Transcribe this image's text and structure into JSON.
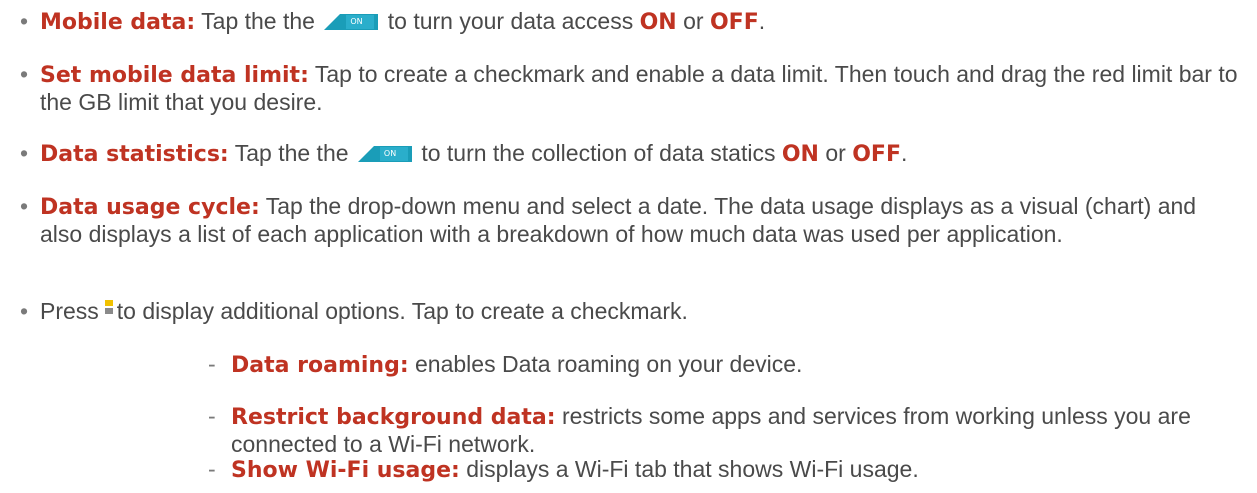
{
  "bullet": "•",
  "dash": "-",
  "items": [
    {
      "term": "Mobile data:",
      "pre": "Tap the the",
      "post": "to turn your data access",
      "kw_on": "ON",
      "or": "or",
      "kw_off": "OFF",
      "end": "."
    },
    {
      "term": "Set mobile data limit:",
      "text": "Tap to create a checkmark and enable a data limit. Then touch and drag the red limit bar to the GB limit that you desire."
    },
    {
      "term": "Data statistics:",
      "pre": "Tap the the",
      "post": "to turn the collection of data statics",
      "kw_on": "ON",
      "or": "or",
      "kw_off": "OFF",
      "end": "."
    },
    {
      "term": "Data usage cycle:",
      "text": "Tap the drop-down menu and select a date. The data usage displays as a visual (chart) and also displays a list of each application with a breakdown of how much data was used per application."
    },
    {
      "pre": "Press",
      "post": "to display additional options. Tap to create a checkmark."
    }
  ],
  "subitems": [
    {
      "term": "Data roaming:",
      "text": "enables Data roaming on your device."
    },
    {
      "term": "Restrict background data:",
      "text": "restricts some apps and services from working unless you are connected to a Wi-Fi network."
    },
    {
      "term": "Show Wi-Fi usage:",
      "text": "displays a Wi-Fi tab that shows Wi-Fi usage."
    }
  ],
  "toggle": {
    "label": "ON",
    "color": "#1a9db8",
    "icon": "toggle-on-icon"
  },
  "menu_icon": {
    "icon": "overflow-menu-icon",
    "colors": [
      "#f2c200",
      "#8a8a8a"
    ]
  },
  "accent": "#bf3322"
}
